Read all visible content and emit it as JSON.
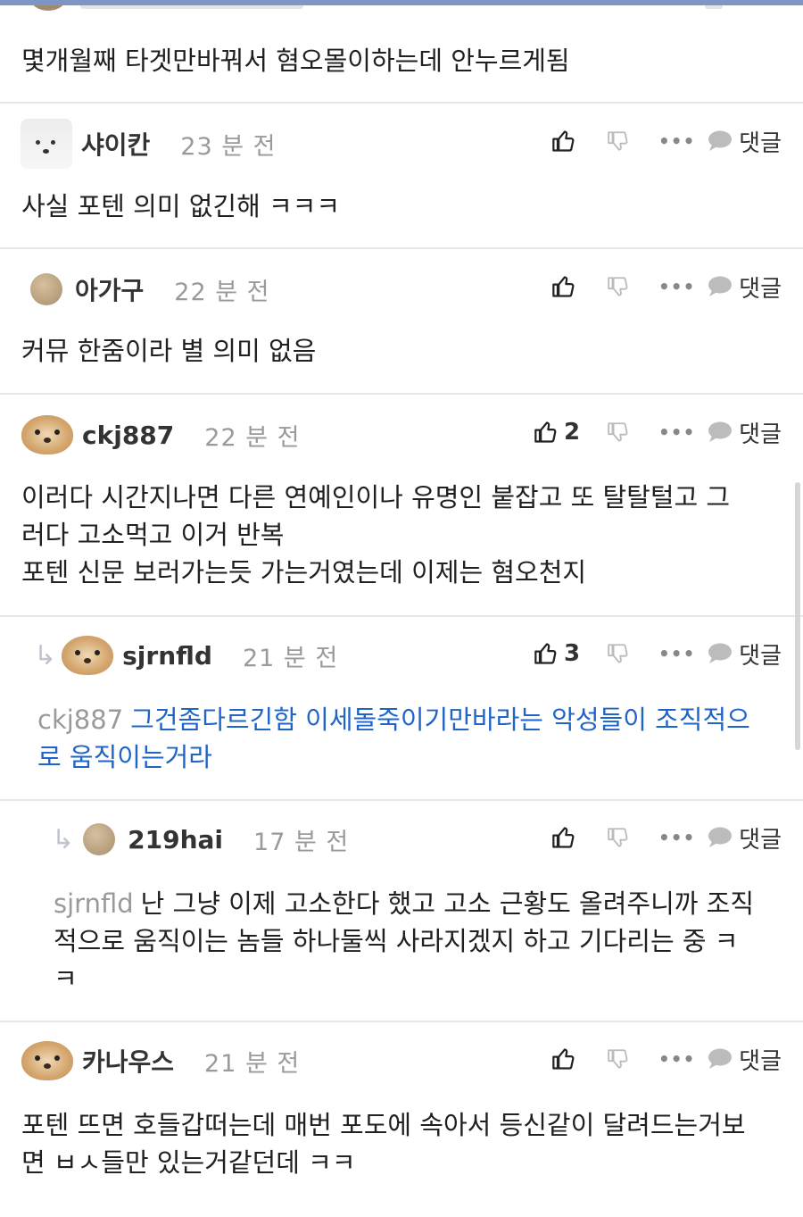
{
  "top_comment": {
    "text": "몇개월째 타겟만바꿔서 혐오몰이하는데 안누르게됨"
  },
  "comments": [
    {
      "user": "샤이칸",
      "time": "23 분 전",
      "likes": "",
      "text": "사실 포텐 의미 없긴해 ㅋㅋㅋ"
    },
    {
      "user": "아가구",
      "time": "22 분 전",
      "likes": "",
      "text": "커뮤 한줌이라 별 의미 없음"
    },
    {
      "user": "ckj887",
      "time": "22 분 전",
      "likes": "2",
      "text_lines": [
        "이러다 시간지나면 다른 연예인이나 유명인 붙잡고 또 탈탈털고 그",
        "러다 고소먹고 이거 반복",
        "포텐 신문 보러가는듯 가는거였는데 이제는 혐오천지"
      ]
    },
    {
      "user": "sjrnfld",
      "time": "21 분 전",
      "likes": "3",
      "reply_to": "ckj887",
      "text_lines": [
        "그건좀다르긴함 이세돌죽이기만바라는 악성들이 조직적으",
        "로 움직이는거라"
      ]
    },
    {
      "user": "219hai",
      "time": "17 분 전",
      "likes": "",
      "reply_to": "sjrnfld",
      "text_lines": [
        "난 그냥 이제 고소한다 했고 고소 근황도 올려주니까 조직",
        "적으로 움직이는 놈들 하나둘씩 사라지겠지 하고 기다리는 중 ㅋ",
        "ㅋ"
      ]
    },
    {
      "user": "카나우스",
      "time": "21 분 전",
      "likes": "",
      "text_lines": [
        "포텐 뜨면 호들갑떠는데 매번 포도에 속아서 등신같이 달려드는거보",
        "면 ㅂㅅ들만 있는거같던데 ㅋㅋ"
      ]
    }
  ],
  "actions": {
    "reply_label": "댓글",
    "more_label": "•••"
  },
  "icons": {
    "like": "thumbs-up-icon",
    "dislike": "thumbs-down-icon",
    "more": "more-dots-icon",
    "reply": "speech-bubble-icon",
    "reply_arrow": "reply-arrow-icon"
  },
  "colors": {
    "top_bar": "#7e96c4",
    "reply_highlight": "#1f64c8",
    "muted": "#9a9a9a"
  }
}
